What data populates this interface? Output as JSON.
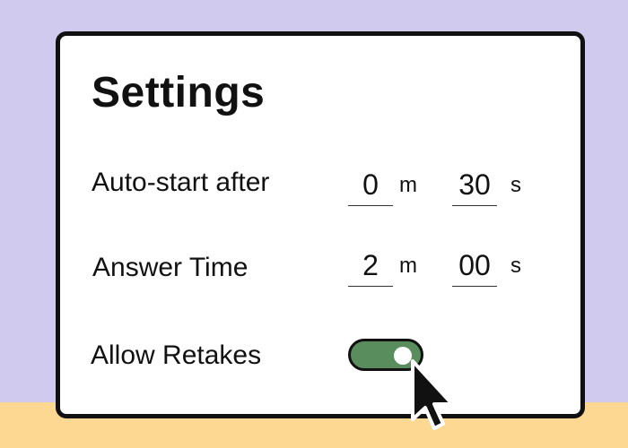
{
  "settings": {
    "title": "Settings",
    "auto_start": {
      "label": "Auto-start after",
      "minutes": "0",
      "minutes_unit": "m",
      "seconds": "30",
      "seconds_unit": "s"
    },
    "answer_time": {
      "label": "Answer Time",
      "minutes": "2",
      "minutes_unit": "m",
      "seconds": "00",
      "seconds_unit": "s"
    },
    "allow_retakes": {
      "label": "Allow Retakes",
      "enabled": true
    }
  },
  "colors": {
    "background": "#d0cbee",
    "floor": "#fdd892",
    "toggle_on": "#5a8d5e"
  },
  "icons": {
    "cursor": "mouse-pointer-icon"
  }
}
